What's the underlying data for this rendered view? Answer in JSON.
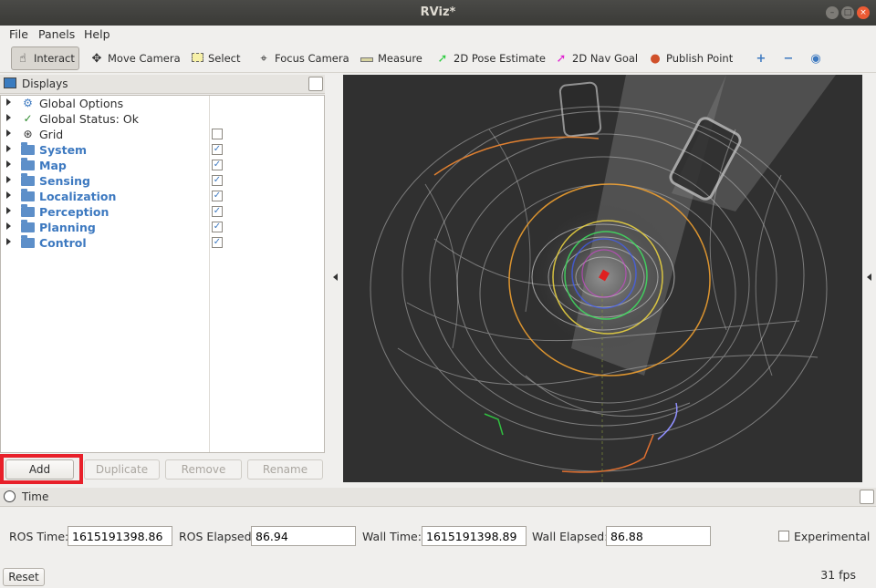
{
  "window": {
    "title": "RViz*"
  },
  "menu": [
    "File",
    "Panels",
    "Help"
  ],
  "toolbar": {
    "tools": [
      {
        "label": "Interact",
        "icon": "hand-pointer-icon",
        "active": true
      },
      {
        "label": "Move Camera",
        "icon": "move-arrows-icon"
      },
      {
        "label": "Select",
        "icon": "select-box-icon"
      },
      {
        "label": "Focus Camera",
        "icon": "crosshair-icon"
      },
      {
        "label": "Measure",
        "icon": "ruler-icon"
      },
      {
        "label": "2D Pose Estimate",
        "icon": "green-arrow-icon"
      },
      {
        "label": "2D Nav Goal",
        "icon": "magenta-arrow-icon"
      },
      {
        "label": "Publish Point",
        "icon": "map-pin-icon"
      }
    ],
    "extras": [
      "plus-icon",
      "minus-icon",
      "eye-icon"
    ]
  },
  "displays": {
    "title": "Displays",
    "items": [
      {
        "label": "Global Options",
        "icon": "gear-icon",
        "group": false
      },
      {
        "label": "Global Status: Ok",
        "icon": "check-icon",
        "group": false
      },
      {
        "label": "Grid",
        "icon": "grid-icon",
        "group": false,
        "checked": false
      },
      {
        "label": "System",
        "icon": "folder-icon",
        "group": true,
        "checked": true
      },
      {
        "label": "Map",
        "icon": "folder-icon",
        "group": true,
        "checked": true
      },
      {
        "label": "Sensing",
        "icon": "folder-icon",
        "group": true,
        "checked": true
      },
      {
        "label": "Localization",
        "icon": "folder-icon",
        "group": true,
        "checked": true
      },
      {
        "label": "Perception",
        "icon": "folder-icon",
        "group": true,
        "checked": true
      },
      {
        "label": "Planning",
        "icon": "folder-icon",
        "group": true,
        "checked": true
      },
      {
        "label": "Control",
        "icon": "folder-icon",
        "group": true,
        "checked": true
      }
    ],
    "buttons": {
      "add": "Add",
      "duplicate": "Duplicate",
      "remove": "Remove",
      "rename": "Rename"
    }
  },
  "time": {
    "title": "Time",
    "ros_time_label": "ROS Time:",
    "ros_time": "1615191398.86",
    "ros_elapsed_label": "ROS Elapsed:",
    "ros_elapsed": "86.94",
    "wall_time_label": "Wall Time:",
    "wall_time": "1615191398.89",
    "wall_elapsed_label": "Wall Elapsed:",
    "wall_elapsed": "86.88",
    "experimental_label": "Experimental",
    "reset_label": "Reset",
    "fps": "31 fps"
  },
  "colors": {
    "highlight": "#e8202a",
    "accent": "#3d79c0",
    "viewport_bg": "#303030"
  }
}
